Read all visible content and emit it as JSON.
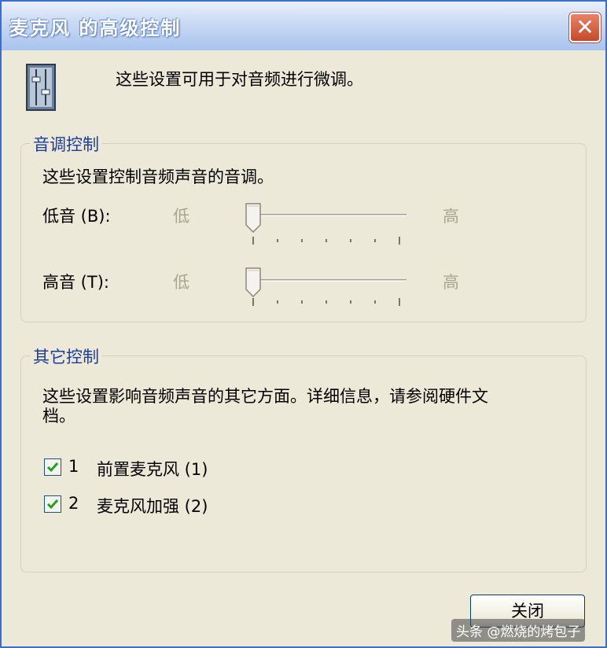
{
  "window": {
    "title": "麦克风 的高级控制",
    "close_symbol": "✕"
  },
  "intro": "这些设置可用于对音频进行微调。",
  "tone": {
    "group_label": "音调控制",
    "description": "这些设置控制音频声音的音调。",
    "sliders": [
      {
        "label": "低音 (B):",
        "min_label": "低",
        "max_label": "高",
        "value_fraction": 0.0
      },
      {
        "label": "高音 (T):",
        "min_label": "低",
        "max_label": "高",
        "value_fraction": 0.0
      }
    ]
  },
  "other": {
    "group_label": "其它控制",
    "description_line1": "这些设置影响音频声音的其它方面。详细信息，请参阅硬件文",
    "description_line2": "档。",
    "options": [
      {
        "number": "1",
        "label": "前置麦克风 (1)",
        "checked": true
      },
      {
        "number": "2",
        "label": "麦克风加强 (2)",
        "checked": true
      }
    ]
  },
  "buttons": {
    "close": "关闭"
  },
  "watermark": "头条 @燃烧的烤包子",
  "colors": {
    "titlebar": "#a8c3ee",
    "close_button": "#c44a2a",
    "group_label": "#1c3d9c",
    "dialog_bg": "#ece9d8"
  }
}
